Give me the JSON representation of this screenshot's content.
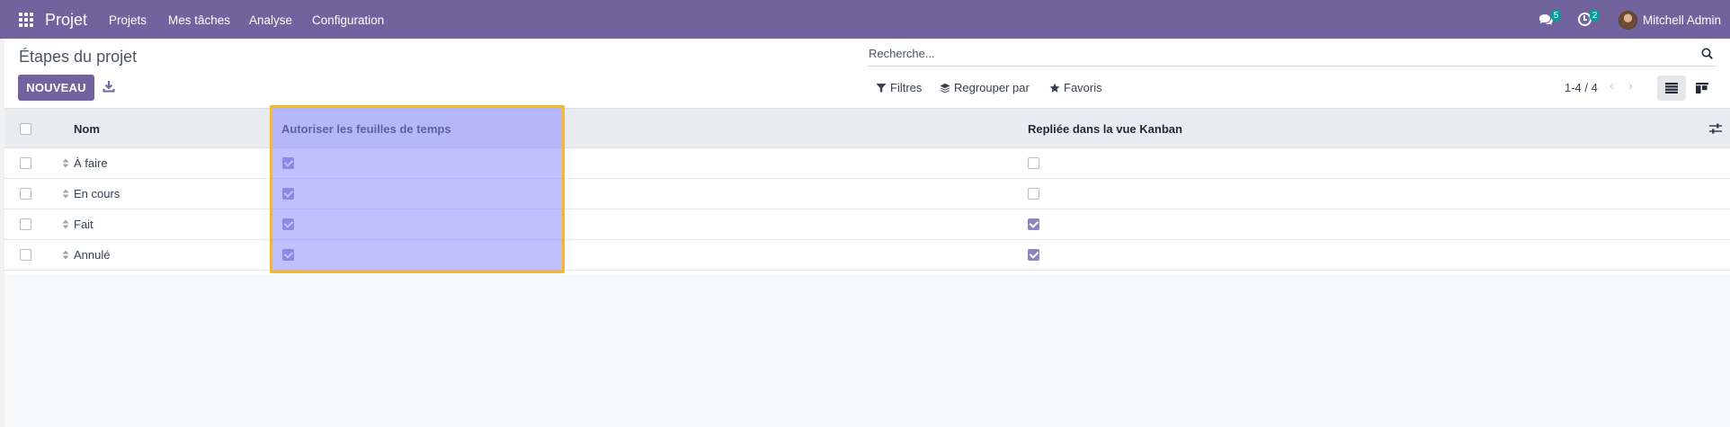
{
  "navbar": {
    "brand": "Projet",
    "menu": [
      "Projets",
      "Mes tâches",
      "Analyse",
      "Configuration"
    ],
    "messages_badge": "5",
    "activities_badge": "2",
    "user_name": "Mitchell Admin",
    "color": "#71639e"
  },
  "control_panel": {
    "title": "Étapes du projet",
    "new_button": "NOUVEAU",
    "search_placeholder": "Recherche...",
    "filters": "Filtres",
    "group_by": "Regrouper par",
    "favorites": "Favoris",
    "pager": "1-4 / 4"
  },
  "table": {
    "headers": {
      "name": "Nom",
      "timesheets": "Autoriser les feuilles de temps",
      "folded": "Repliée dans la vue Kanban"
    },
    "rows": [
      {
        "name": "À faire",
        "timesheets": true,
        "folded": false
      },
      {
        "name": "En cours",
        "timesheets": true,
        "folded": false
      },
      {
        "name": "Fait",
        "timesheets": true,
        "folded": true
      },
      {
        "name": "Annulé",
        "timesheets": true,
        "folded": true
      }
    ]
  },
  "colors": {
    "accent": "#71639e",
    "highlight_border": "#f7b928",
    "checkbox_checked": "#8f84c0"
  }
}
